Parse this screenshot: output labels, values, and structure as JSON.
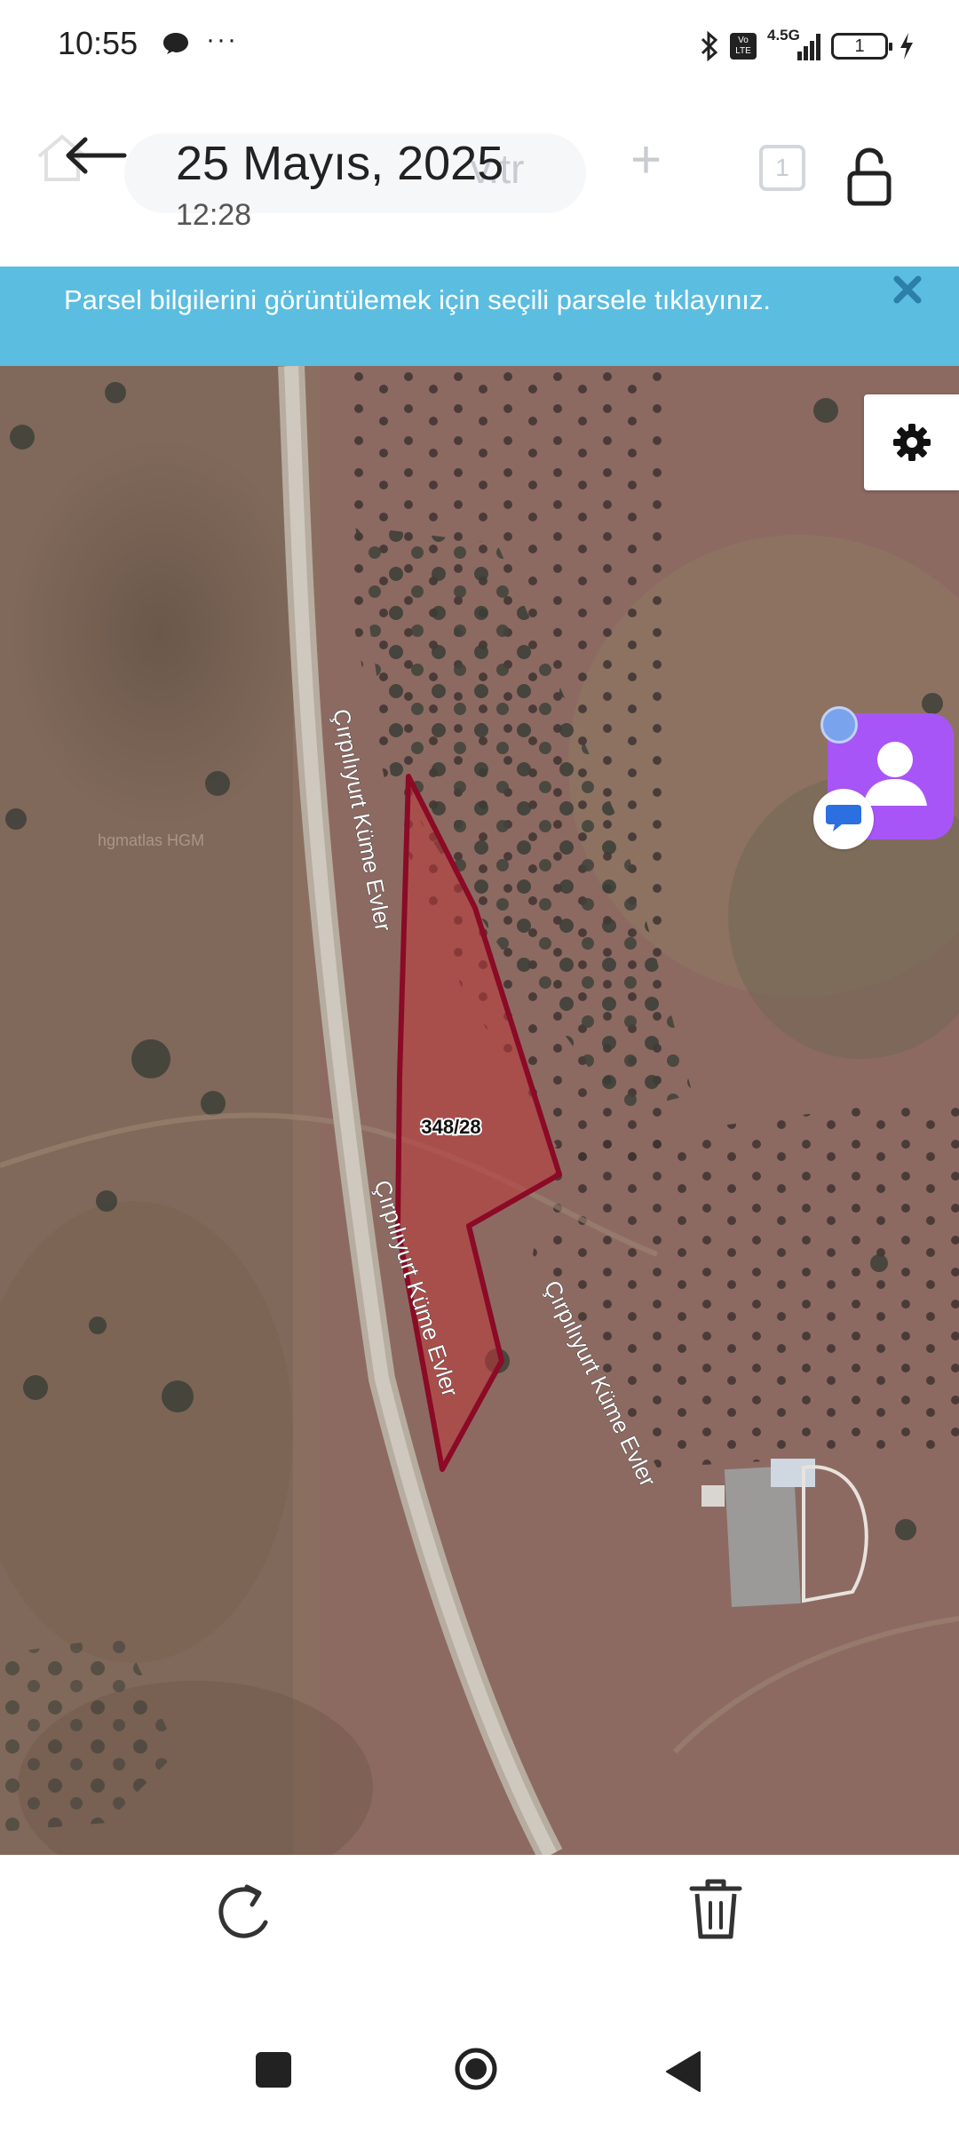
{
  "status_bar": {
    "time": "10:55",
    "more": "···",
    "network": "4.5G",
    "volte": "Vo LTE",
    "battery_level": "1",
    "icons": [
      "chat-bubble-icon",
      "bluetooth-icon",
      "volte-icon",
      "signal-icon",
      "battery-icon",
      "charging-bolt-icon"
    ]
  },
  "header": {
    "date": "25 Mayıs, 2025",
    "time": "12:28",
    "ghost_url_text": "v.tr",
    "ghost_tabs_count": "1"
  },
  "banner": {
    "text": "Parsel bilgilerini görüntülemek için seçili parsele tıklayınız."
  },
  "map": {
    "parcel_label": "348/28",
    "road_label_1": "Çırpılıyurt Küme Evler",
    "road_label_2": "Çırpılıyurt Küme Evler",
    "road_label_3": "Çırpılıyurt Küme Evler",
    "watermark": "hgmatlas HGM",
    "parcel_fill": "#c0393b",
    "parcel_stroke": "#8b0a26"
  },
  "colors": {
    "banner": "#5bbde0",
    "assistant": "#a855f7"
  }
}
